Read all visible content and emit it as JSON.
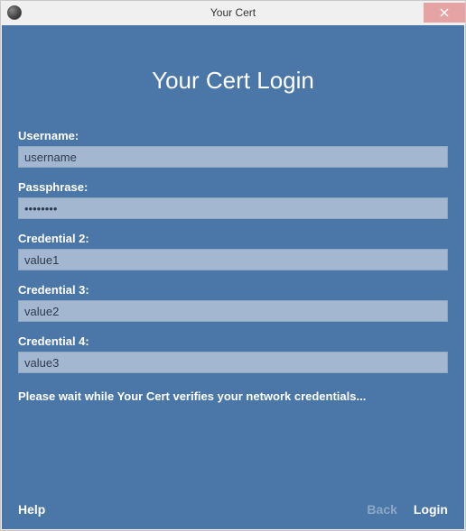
{
  "window": {
    "title": "Your Cert"
  },
  "heading": "Your Cert Login",
  "fields": [
    {
      "label": "Username:",
      "value": "username",
      "type": "text"
    },
    {
      "label": "Passphrase:",
      "value": "••••••••",
      "type": "password"
    },
    {
      "label": "Credential 2:",
      "value": "value1",
      "type": "text"
    },
    {
      "label": "Credential 3:",
      "value": "value2",
      "type": "text"
    },
    {
      "label": "Credential 4:",
      "value": "value3",
      "type": "text"
    }
  ],
  "status": "Please wait while Your Cert verifies your network credentials...",
  "footer": {
    "help": "Help",
    "back": "Back",
    "login": "Login"
  }
}
